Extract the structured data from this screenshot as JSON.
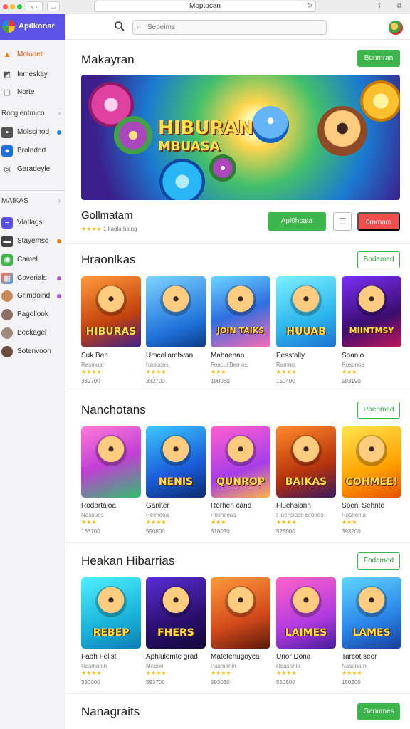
{
  "browser": {
    "address": "Moptocan"
  },
  "sidebar": {
    "brand": "Apilkonar",
    "top_items": [
      {
        "label": "Molonet",
        "icon": "warning-icon"
      },
      {
        "label": "Inmeskay",
        "icon": "image-icon"
      },
      {
        "label": "Norte",
        "icon": "note-icon"
      }
    ],
    "section1": "Rocgientmico",
    "mid_items": [
      {
        "label": "Molssinod",
        "icon": "monitor-icon"
      },
      {
        "label": "Brolndort",
        "icon": "shield-icon"
      },
      {
        "label": "Garadeyle",
        "icon": "circle-icon"
      }
    ],
    "section2": "MAIKAS",
    "library_items": [
      {
        "label": "Vlatlags",
        "icon": "list-icon"
      },
      {
        "label": "Stayemsc",
        "icon": "gamepad-icon",
        "badge_color": "#f57c00"
      },
      {
        "label": "Camel",
        "icon": "chat-icon"
      },
      {
        "label": "Coverials",
        "icon": "grid-icon",
        "badge_color": "#b05ad8"
      },
      {
        "label": "Grimdoind",
        "icon": "avatar-icon",
        "badge_color": "#b05ad8"
      },
      {
        "label": "Pagollook",
        "icon": "avatar-icon"
      },
      {
        "label": "Beckagel",
        "icon": "avatar-icon"
      },
      {
        "label": "Sotenvoon",
        "icon": "avatar-icon"
      }
    ]
  },
  "topbar": {
    "search_placeholder": "Sepeims"
  },
  "hero": {
    "title": "Makayran",
    "button": "Bonmran",
    "banner_title": "HIBURAN",
    "banner_subtitle": "MBUASA",
    "featured_name": "Gollmatam",
    "featured_stars": "★★★★",
    "featured_meta": "1 kagla haing",
    "install_button": "Apl0hcata",
    "menu_icon": "menu-icon",
    "secondary_button": "0mmam"
  },
  "sections": [
    {
      "title": "Hraonlkas",
      "button": "Bodamed",
      "tiles": [
        {
          "name": "Suk Ban",
          "sub": "Rasmuan",
          "stars": "★★★★",
          "count": "332700",
          "art": "HIBURAS",
          "bg": "linear-gradient(160deg,#ff9a3c,#c2410c 60%,#3b1f8c)"
        },
        {
          "name": "Umcoliambvan",
          "sub": "Nasoons",
          "stars": "★★★★",
          "count": "332700",
          "art": "",
          "bg": "linear-gradient(160deg,#7ed3ff,#1e6fd9 70%,#0c3a80)"
        },
        {
          "name": "Mabaenan",
          "sub": "Foacul Bernos",
          "stars": "★★★",
          "count": "190060",
          "art": "JOIN TAIKS",
          "bg": "linear-gradient(160deg,#6bd6ff,#2f6fe0 50%,#ff6bb5)"
        },
        {
          "name": "Pesstally",
          "sub": "Ramnol",
          "stars": "★★★★",
          "count": "150400",
          "art": "HUUAB",
          "bg": "linear-gradient(160deg,#7ef0ff,#2bb6ec 60%,#1c6fd0)"
        },
        {
          "name": "Soanio",
          "sub": "Rosonos",
          "stars": "★★★",
          "count": "593190",
          "art": "MIINTMSY",
          "bg": "linear-gradient(160deg,#7b2ff7,#3a0d6e 60%,#c2185b)"
        }
      ]
    },
    {
      "title": "Nanchotans",
      "button": "Poenmed",
      "tiles": [
        {
          "name": "Rodortaloa",
          "sub": "Nasoues",
          "stars": "★★★",
          "count": "163700",
          "art": "",
          "bg": "linear-gradient(160deg,#ff7ad9,#c13fd6 50%,#2fbf6b)"
        },
        {
          "name": "Ganiter",
          "sub": "Relmooa",
          "stars": "★★★★",
          "count": "590800",
          "art": "NENIS",
          "bg": "linear-gradient(160deg,#3bc7ff,#1a5bd8 60%,#0d2c6e)"
        },
        {
          "name": "Rorhen cand",
          "sub": "Posnecoa",
          "stars": "★★★",
          "count": "516030",
          "art": "QUNROP",
          "bg": "linear-gradient(160deg,#ff5fd0,#a63ee8 60%,#ffb347)"
        },
        {
          "name": "Fluehsiann",
          "sub": "Fluehsiasn Bronos",
          "stars": "★★★★",
          "count": "528000",
          "art": "BAIKAS",
          "bg": "linear-gradient(160deg,#ff8a2a,#b5320c 60%,#3a1a60)"
        },
        {
          "name": "Spenl Sehnte",
          "sub": "Rosnonia",
          "stars": "★★★",
          "count": "393200",
          "art": "COHMEE!",
          "bg": "linear-gradient(160deg,#ffe54d,#ffa000 60%,#e65100)"
        }
      ]
    },
    {
      "title": "Heakan Hibarrias",
      "button": "Fodamed",
      "tiles": [
        {
          "name": "Fabh Felist",
          "sub": "Rasmanin",
          "stars": "★★★★",
          "count": "330000",
          "art": "REBEP",
          "bg": "linear-gradient(160deg,#4ff0ff,#19b3d9 60%,#0e7fb0)"
        },
        {
          "name": "Aphlulemte grad",
          "sub": "Meeon",
          "stars": "★★★★",
          "count": "593700",
          "art": "FHERS",
          "bg": "linear-gradient(160deg,#5a2dd8,#2a0f6e 60%,#140639)"
        },
        {
          "name": "Matetenugoyca",
          "sub": "Pasmanin",
          "stars": "★★★★",
          "count": "593030",
          "art": "",
          "bg": "linear-gradient(160deg,#ff9a3c,#d1491b 60%,#5a1a0a)"
        },
        {
          "name": "Unor Dona",
          "sub": "Reasonia",
          "stars": "★★★★",
          "count": "550800",
          "art": "LAIMES",
          "bg": "linear-gradient(160deg,#ff62c8,#b23be0 60%,#4a1b9b)"
        },
        {
          "name": "Tarcot seer",
          "sub": "Nasanam",
          "stars": "★★★★",
          "count": "150200",
          "art": "LAMES",
          "bg": "linear-gradient(160deg,#5fd7ff,#2a83e8 60%,#173d9c)"
        }
      ]
    }
  ],
  "footer_section": {
    "title": "Nanagraits",
    "button": "Ganumes"
  },
  "colors": {
    "accent": "#5b52e6",
    "green": "#3cb54a",
    "red": "#f04d4d",
    "star": "#f2b705"
  }
}
